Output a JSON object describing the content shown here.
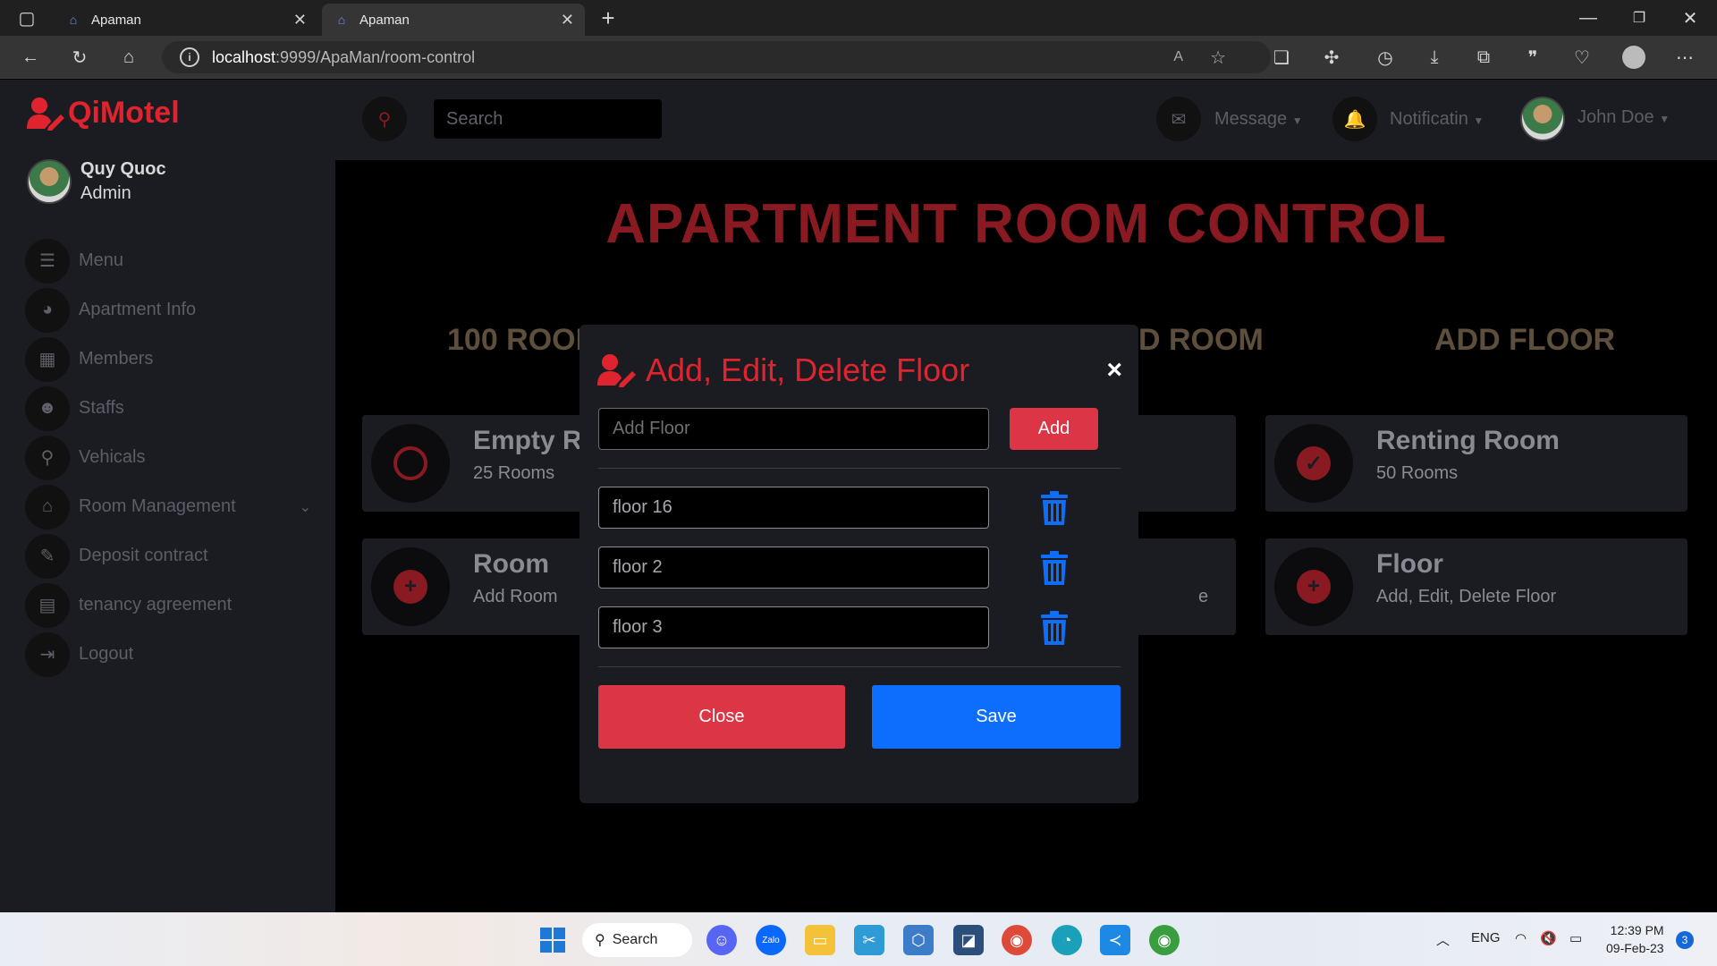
{
  "browser": {
    "tabs": [
      {
        "title": "Apaman"
      },
      {
        "title": "Apaman"
      }
    ],
    "url_host": "localhost",
    "url_path": ":9999/ApaMan/room-control"
  },
  "sidebar": {
    "brand": "QiMotel",
    "user_name": "Quy Quoc",
    "user_role": "Admin",
    "items": [
      {
        "label": "Menu"
      },
      {
        "label": "Apartment Info"
      },
      {
        "label": "Members"
      },
      {
        "label": "Staffs"
      },
      {
        "label": "Vehicals"
      },
      {
        "label": "Room Management"
      },
      {
        "label": "Deposit contract"
      },
      {
        "label": "tenancy agreement"
      },
      {
        "label": "Logout"
      }
    ]
  },
  "topbar": {
    "search_placeholder": "Search",
    "message_label": "Message",
    "notification_label": "Notificatin",
    "user_label": "John Doe"
  },
  "page": {
    "title": "APARTMENT ROOM CONTROL",
    "stats": [
      "100 ROOM",
      "D ROOM",
      "ADD FLOOR"
    ],
    "cards": [
      {
        "title": "Empty Ro",
        "sub": "25 Rooms"
      },
      {
        "title": "Renting Room",
        "sub": "50 Rooms"
      },
      {
        "title": "Room",
        "sub": "Add Room"
      },
      {
        "title": "",
        "sub": "e"
      },
      {
        "title": "Floor",
        "sub": "Add, Edit, Delete Floor"
      }
    ]
  },
  "modal": {
    "title": "Add, Edit, Delete Floor",
    "close_glyph": "×",
    "add_placeholder": "Add Floor",
    "add_label": "Add",
    "floors": [
      {
        "value": "floor 16"
      },
      {
        "value": "floor 2"
      },
      {
        "value": "floor 3"
      }
    ],
    "close_label": "Close",
    "save_label": "Save"
  },
  "taskbar": {
    "search_label": "Search",
    "language": "ENG",
    "time": "12:39 PM",
    "date": "09-Feb-23",
    "notification_count": "3"
  },
  "colors": {
    "accent_red": "#e0242f",
    "danger": "#dc3545",
    "primary": "#0d6efd",
    "panel": "#1b1c22"
  }
}
